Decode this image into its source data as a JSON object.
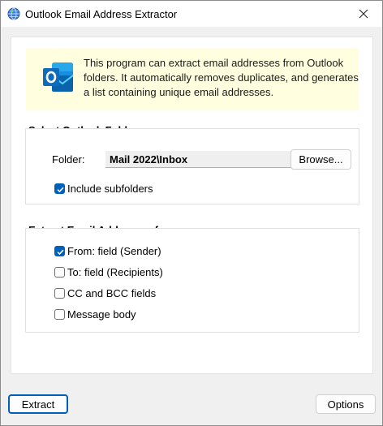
{
  "window": {
    "title": "Outlook Email Address Extractor",
    "close_glyph": "✕"
  },
  "info": {
    "text": "This program can extract email addresses from Outlook folders. It automatically removes duplicates, and generates a list containing unique email addresses.",
    "icon": "outlook-icon"
  },
  "folder_section": {
    "title": "Select Outlook Folder",
    "folder_label": "Folder:",
    "folder_value": "Mail 2022\\Inbox",
    "browse_label": "Browse...",
    "include_subfolders_label": "Include subfolders",
    "include_subfolders_checked": true
  },
  "extract_section": {
    "title": "Extract Email Addresses from",
    "options": [
      {
        "label": "From: field (Sender)",
        "checked": true
      },
      {
        "label": "To: field (Recipients)",
        "checked": false
      },
      {
        "label": "CC and BCC fields",
        "checked": false
      },
      {
        "label": "Message body",
        "checked": false
      }
    ]
  },
  "footer": {
    "extract_label": "Extract",
    "options_label": "Options"
  },
  "colors": {
    "accent": "#005fb8",
    "info_bg": "#ffffe0"
  }
}
